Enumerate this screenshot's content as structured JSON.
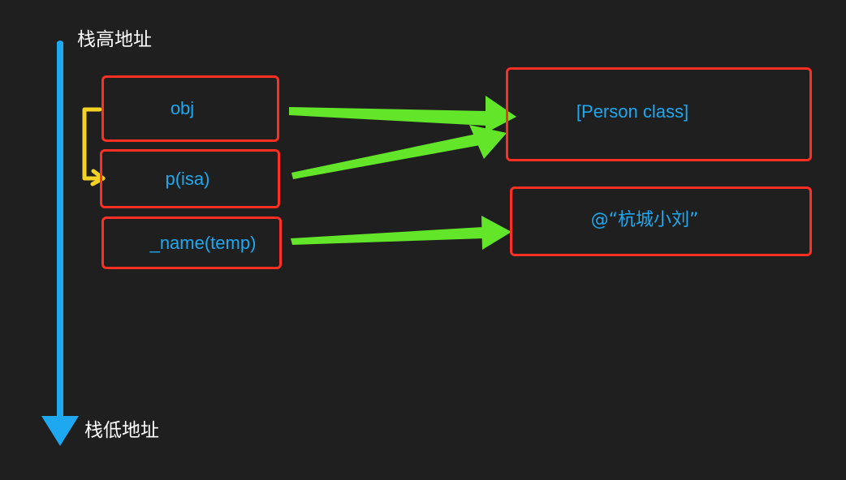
{
  "stack_axis": {
    "top_label": "栈高地址",
    "bottom_label": "栈低地址"
  },
  "stack_slots": [
    {
      "text": "obj"
    },
    {
      "text": "p(isa)"
    },
    {
      "text": "_name(temp)"
    }
  ],
  "heap_objects": [
    {
      "text": "[Person class]"
    },
    {
      "text": "@“杭城小刘”"
    }
  ],
  "colors": {
    "background": "#1f1f1f",
    "box_border": "#ff2f24",
    "text": "#1ea8f0",
    "axis_arrow": "#1ea8f0",
    "pointer_arrow": "#63e62a",
    "isa_bracket": "#f5d324",
    "axis_label": "#ffffff"
  }
}
